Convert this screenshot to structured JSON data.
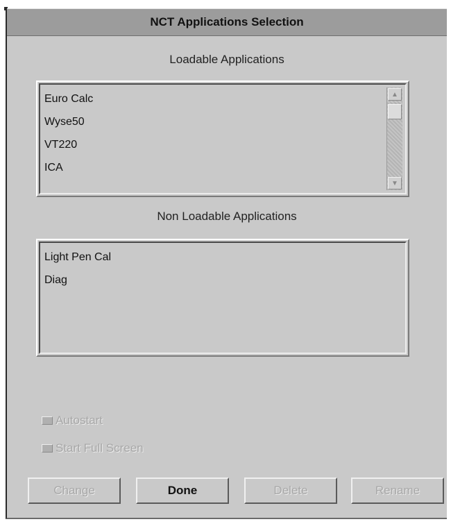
{
  "window": {
    "title": "NCT Applications Selection"
  },
  "loadable": {
    "label": "Loadable Applications",
    "items": [
      "Euro Calc",
      "Wyse50",
      "VT220",
      "ICA"
    ]
  },
  "non_loadable": {
    "label": "Non Loadable Applications",
    "items": [
      "Light Pen Cal",
      "Diag"
    ]
  },
  "options": {
    "autostart_label": "Autostart",
    "fullscreen_label": "Start Full Screen"
  },
  "buttons": {
    "change_label": "Change",
    "done_label": "Done",
    "delete_label": "Delete",
    "rename_label": "Rename"
  },
  "colors": {
    "dialog_bg": "#c9c9c9",
    "titlebar_bg": "#9c9c9c",
    "disabled_text": "#a8a8a8"
  },
  "icons": {
    "scroll_up": "scroll-up-arrow-icon",
    "scroll_down": "scroll-down-arrow-icon",
    "checkbox": "checkbox-icon"
  }
}
